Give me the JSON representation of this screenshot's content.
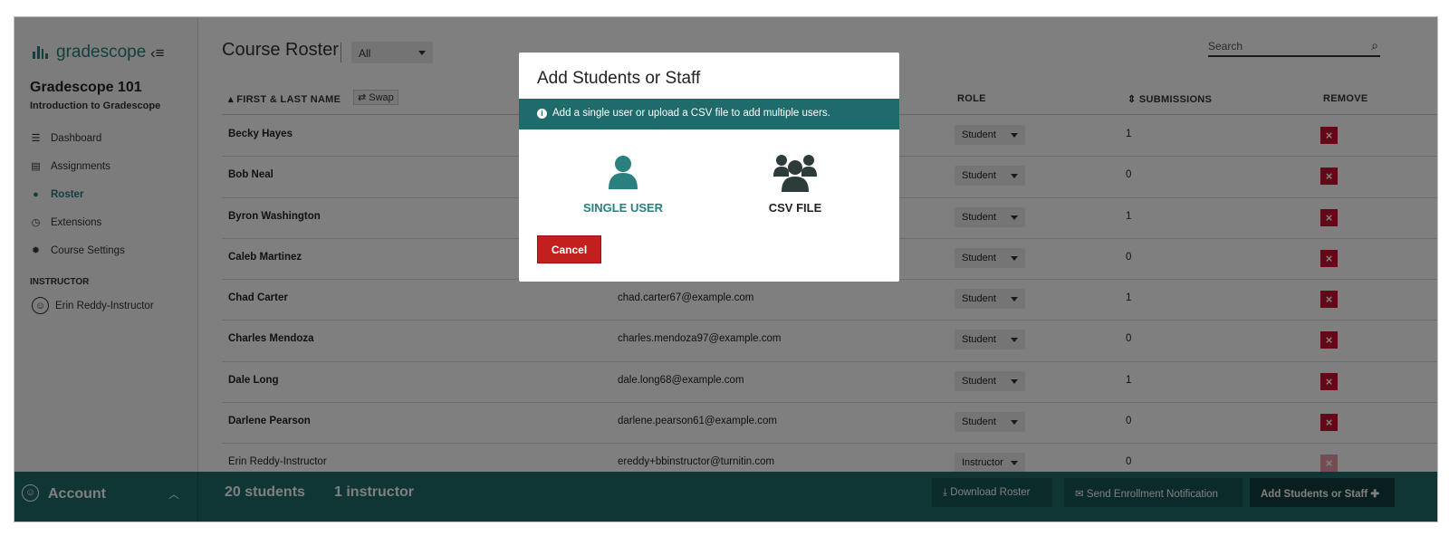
{
  "app": {
    "brand": "gradescope",
    "course_title": "Gradescope 101",
    "course_subtitle": "Introduction to Gradescope",
    "accent_color": "#2a7f7f"
  },
  "sidebar": {
    "items": [
      {
        "label": "Dashboard",
        "icon": "dashboard-icon"
      },
      {
        "label": "Assignments",
        "icon": "assignments-icon"
      },
      {
        "label": "Roster",
        "icon": "roster-icon",
        "active": true
      },
      {
        "label": "Extensions",
        "icon": "clock-icon"
      },
      {
        "label": "Course Settings",
        "icon": "gear-icon"
      }
    ],
    "section_label": "INSTRUCTOR",
    "instructor_name": "Erin Reddy-Instructor"
  },
  "header": {
    "title": "Course Roster",
    "filter_value": "All",
    "search_placeholder": "Search"
  },
  "table": {
    "headers": {
      "name": "FIRST & LAST NAME",
      "swap": "Swap",
      "role": "ROLE",
      "submissions": "SUBMISSIONS",
      "remove": "REMOVE"
    },
    "rows": [
      {
        "name": "Becky Hayes",
        "email": "",
        "role": "Student",
        "submissions": "1"
      },
      {
        "name": "Bob Neal",
        "email": "",
        "role": "Student",
        "submissions": "0"
      },
      {
        "name": "Byron Washington",
        "email": "",
        "role": "Student",
        "submissions": "1"
      },
      {
        "name": "Caleb Martinez",
        "email": "",
        "role": "Student",
        "submissions": "0"
      },
      {
        "name": "Chad Carter",
        "email": "chad.carter67@example.com",
        "role": "Student",
        "submissions": "1"
      },
      {
        "name": "Charles Mendoza",
        "email": "charles.mendoza97@example.com",
        "role": "Student",
        "submissions": "0"
      },
      {
        "name": "Dale Long",
        "email": "dale.long68@example.com",
        "role": "Student",
        "submissions": "1"
      },
      {
        "name": "Darlene Pearson",
        "email": "darlene.pearson61@example.com",
        "role": "Student",
        "submissions": "0"
      },
      {
        "name": "Erin Reddy-Instructor",
        "email": "ereddy+bbinstructor@turnitin.com",
        "role": "Instructor",
        "submissions": "0"
      }
    ]
  },
  "footer": {
    "account_label": "Account",
    "students_count": "20 students",
    "instructor_count": "1 instructor",
    "download_label": "Download Roster",
    "notify_label": "Send Enrollment Notification",
    "add_label": "Add Students or Staff"
  },
  "modal": {
    "title": "Add Students or Staff",
    "info": "Add a single user or upload a CSV file to add multiple users.",
    "single_label": "SINGLE USER",
    "csv_label": "CSV FILE",
    "cancel_label": "Cancel"
  }
}
